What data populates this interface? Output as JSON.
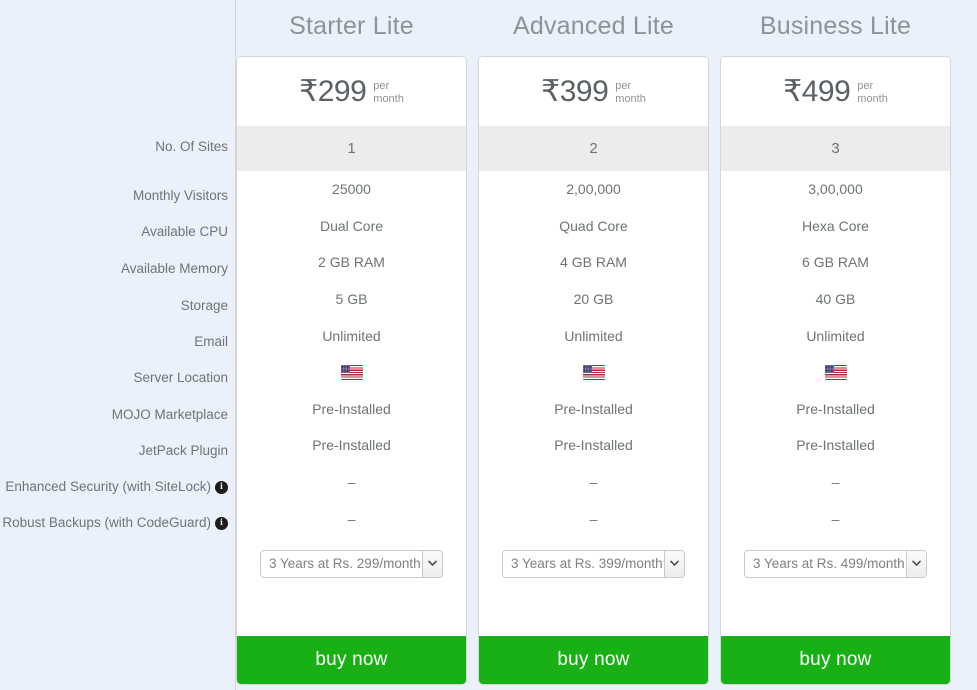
{
  "background_color": "#eaf1fb",
  "accent_color": "#18b014",
  "feature_labels": [
    {
      "text": "No. Of Sites",
      "info": false
    },
    {
      "text": "Monthly Visitors",
      "info": false
    },
    {
      "text": "Available CPU",
      "info": false
    },
    {
      "text": "Available Memory",
      "info": false
    },
    {
      "text": "Storage",
      "info": false
    },
    {
      "text": "Email",
      "info": false
    },
    {
      "text": "Server Location",
      "info": false
    },
    {
      "text": "MOJO Marketplace",
      "info": false
    },
    {
      "text": "JetPack Plugin",
      "info": false
    },
    {
      "text": "Enhanced Security (with SiteLock)",
      "info": true
    },
    {
      "text": "Robust Backups (with CodeGuard)",
      "info": true
    }
  ],
  "info_icon_glyph": "i",
  "plans": [
    {
      "title": "Starter Lite",
      "price": "₹299",
      "period_line1": "per",
      "period_line2": "month",
      "sites": "1",
      "visitors": "25000",
      "cpu": "Dual Core",
      "memory": "2 GB RAM",
      "storage": "5 GB",
      "email": "Unlimited",
      "server_location_icon": "us-flag-icon",
      "mojo": "Pre-Installed",
      "jetpack": "Pre-Installed",
      "sitelock": "–",
      "codeguard": "–",
      "term_selected": "3 Years at Rs. 299/month",
      "buy_label": "buy now"
    },
    {
      "title": "Advanced Lite",
      "price": "₹399",
      "period_line1": "per",
      "period_line2": "month",
      "sites": "2",
      "visitors": "2,00,000",
      "cpu": "Quad Core",
      "memory": "4 GB RAM",
      "storage": "20 GB",
      "email": "Unlimited",
      "server_location_icon": "us-flag-icon",
      "mojo": "Pre-Installed",
      "jetpack": "Pre-Installed",
      "sitelock": "–",
      "codeguard": "–",
      "term_selected": "3 Years at Rs. 399/month",
      "buy_label": "buy now"
    },
    {
      "title": "Business Lite",
      "price": "₹499",
      "period_line1": "per",
      "period_line2": "month",
      "sites": "3",
      "visitors": "3,00,000",
      "cpu": "Hexa Core",
      "memory": "6 GB RAM",
      "storage": "40 GB",
      "email": "Unlimited",
      "server_location_icon": "us-flag-icon",
      "mojo": "Pre-Installed",
      "jetpack": "Pre-Installed",
      "sitelock": "–",
      "codeguard": "–",
      "term_selected": "3 Years at Rs. 499/month",
      "buy_label": "buy now"
    }
  ]
}
